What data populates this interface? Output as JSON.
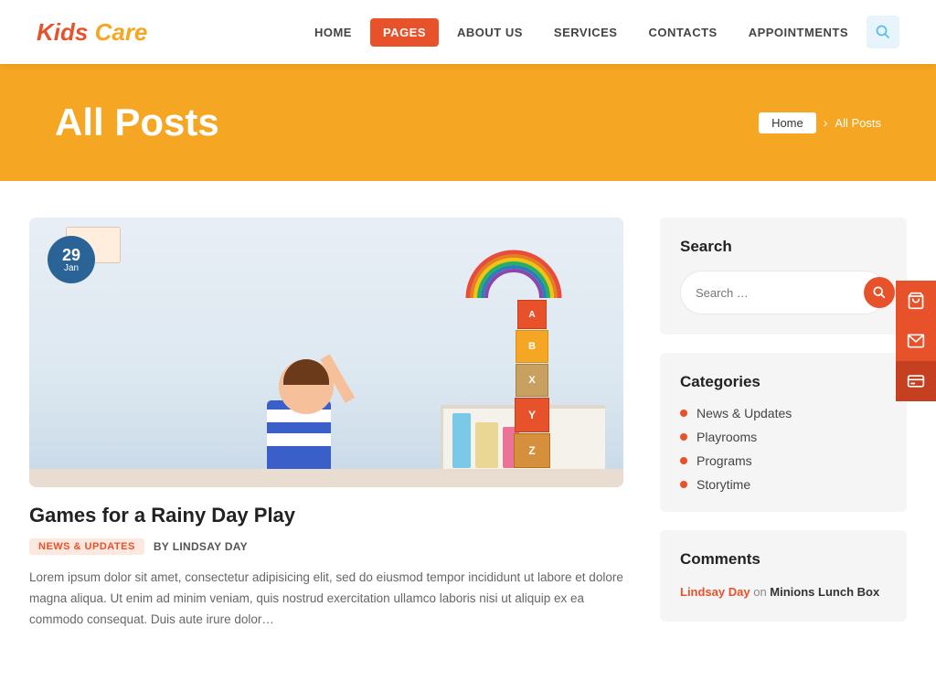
{
  "site": {
    "logo_text": "Kids Care",
    "logo_part1": "Kids ",
    "logo_part2": "Care"
  },
  "nav": {
    "items": [
      {
        "label": "HOME",
        "active": false
      },
      {
        "label": "PAGES",
        "active": true
      },
      {
        "label": "ABOUT US",
        "active": false
      },
      {
        "label": "SERVICES",
        "active": false
      },
      {
        "label": "CONTACTS",
        "active": false
      },
      {
        "label": "APPOINTMENTS",
        "active": false
      }
    ]
  },
  "hero": {
    "title": "All Posts",
    "breadcrumb_home": "Home",
    "breadcrumb_sep": "›",
    "breadcrumb_current": "All Posts"
  },
  "post": {
    "date_day": "29",
    "date_month": "Jan",
    "title": "Games for a Rainy Day Play",
    "tag": "NEWS & UPDATES",
    "author_prefix": "BY",
    "author": "LINDSAY DAY",
    "excerpt": "Lorem ipsum dolor sit amet, consectetur adipisicing elit, sed do eiusmod tempor incididunt ut labore et dolore magna aliqua. Ut enim ad minim veniam, quis nostrud exercitation ullamco laboris nisi ut aliquip ex ea commodo consequat. Duis aute irure dolor…"
  },
  "sidebar": {
    "search": {
      "title": "Search",
      "placeholder": "Search …",
      "button_label": "🔍"
    },
    "categories": {
      "title": "Categories",
      "items": [
        {
          "label": "News & Updates"
        },
        {
          "label": "Playrooms"
        },
        {
          "label": "Programs"
        },
        {
          "label": "Storytime"
        }
      ]
    },
    "comments": {
      "title": "Comments",
      "author": "Lindsay Day",
      "on_text": "on",
      "post_title": "Minions Lunch Box"
    }
  },
  "side_buttons": {
    "cart_icon": "🛒",
    "email_icon": "✉",
    "card_icon": "🪪"
  }
}
